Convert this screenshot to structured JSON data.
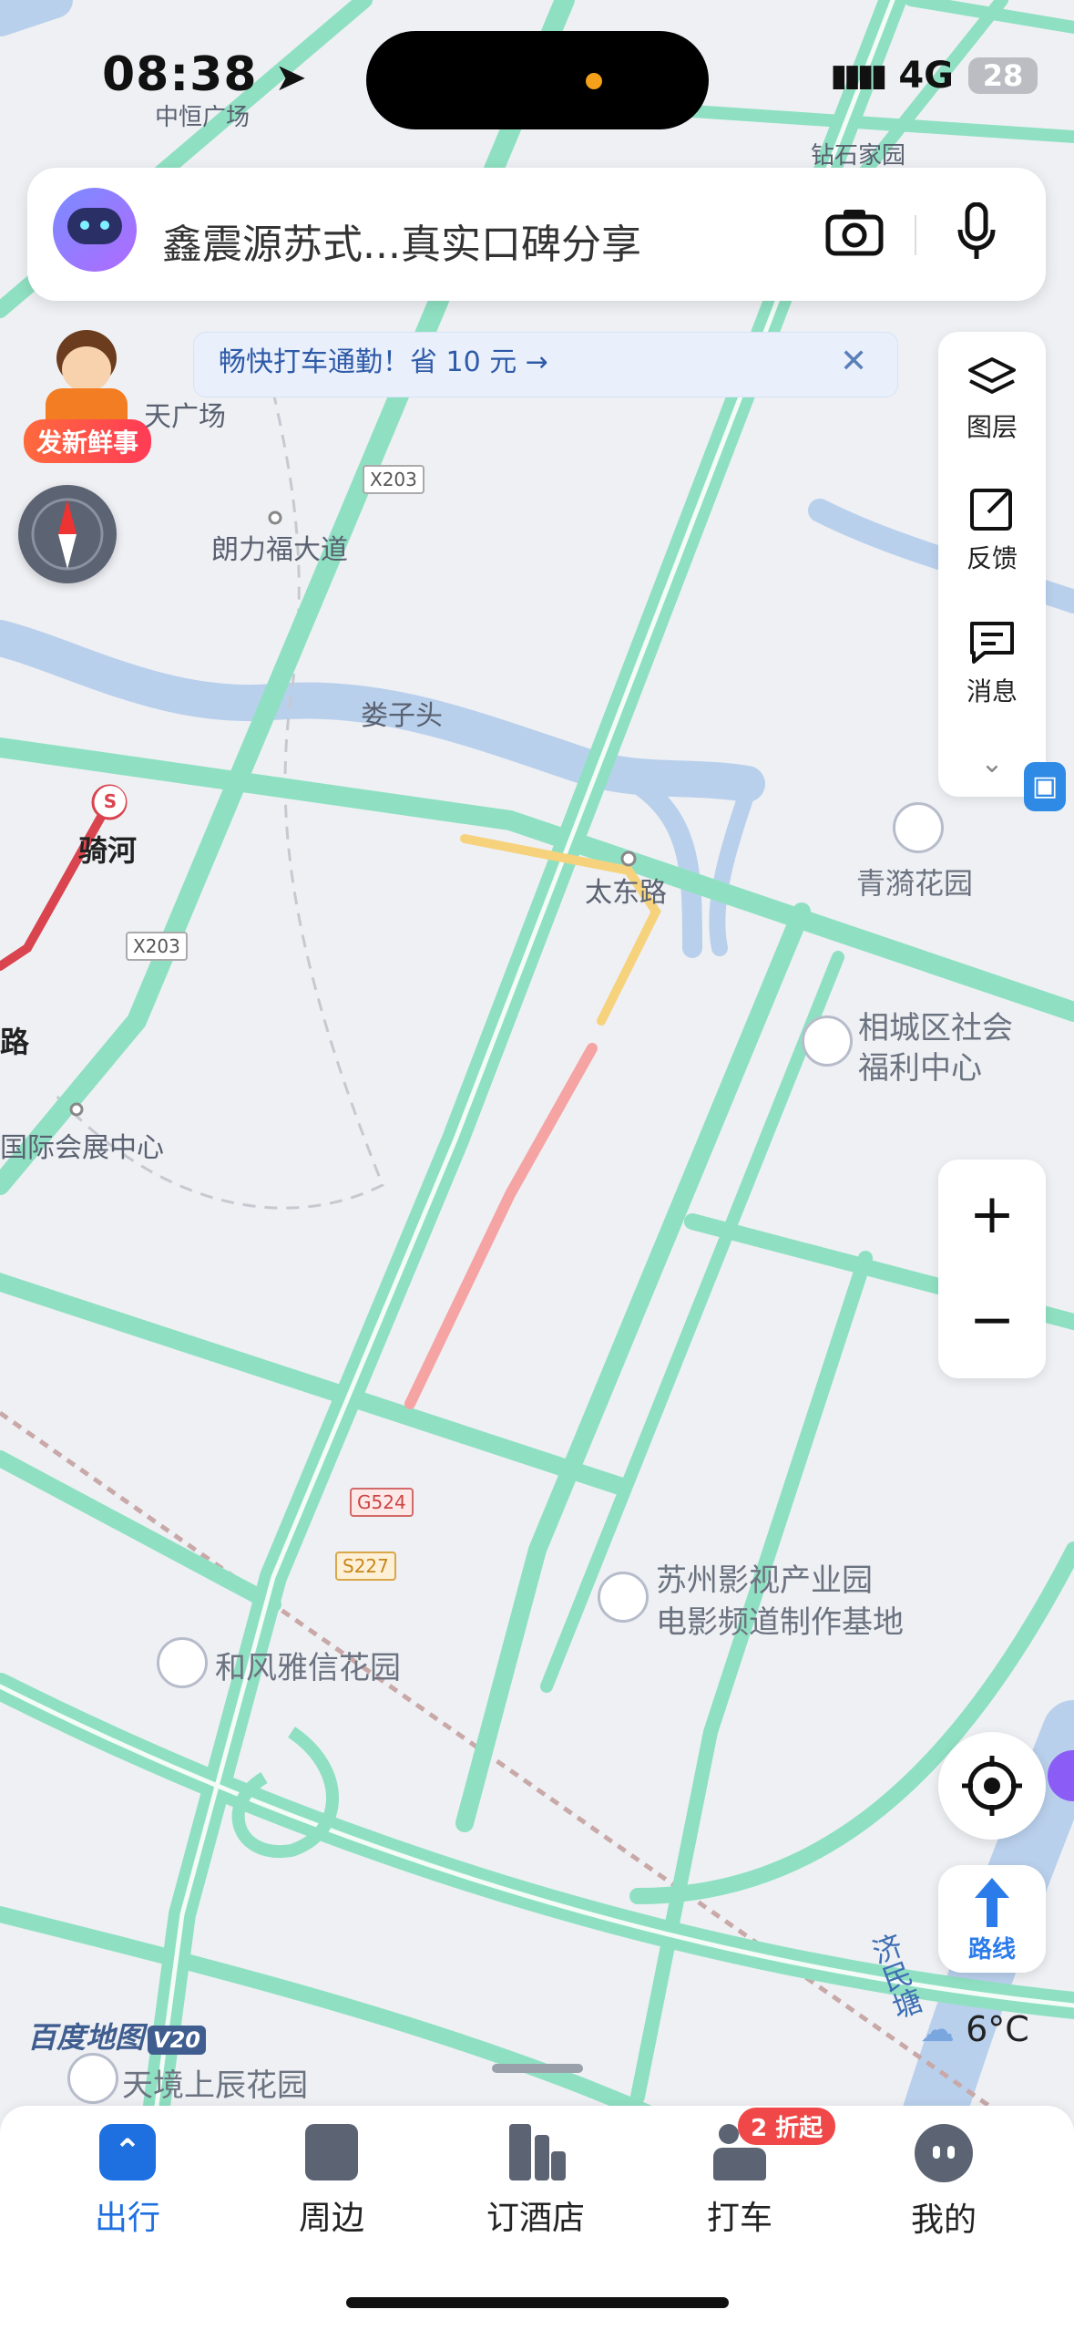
{
  "status_bar": {
    "time": "08:38",
    "network": "4G",
    "battery": "28"
  },
  "search": {
    "text": "鑫震源苏式...真实口碑分享"
  },
  "promo": {
    "text": "畅快打车通勤！省 10 元 →"
  },
  "mascot_badge": "发新鲜事",
  "side_tools": {
    "layers": "图层",
    "feedback": "反馈",
    "messages": "消息"
  },
  "zoom": {
    "in": "+",
    "out": "−"
  },
  "route_button": "路线",
  "weather": {
    "temp": "6°C"
  },
  "brand": {
    "name": "百度地图",
    "version": "V20"
  },
  "map_labels": {
    "zhongheng": "中恒广场",
    "zuanshi": "钻石家园",
    "tian_guangchang": "天广场",
    "langli": "朗力福大道",
    "louzitou": "娄子头",
    "qihe": "骑河",
    "taidong": "太东路",
    "qingyi": "青漪花园",
    "xiangcheng": "相城区社会",
    "xiangcheng2": "福利中心",
    "huizhan": "国际会展中心",
    "lu": "路",
    "yingshi1": "苏州影视产业园",
    "yingshi2": "电影频道制作基地",
    "hefeng": "和风雅信花园",
    "tianjing": "天境上辰花园",
    "jimintang": "济民塘"
  },
  "road_tags": {
    "x203_a": "X203",
    "x203_b": "X203",
    "g524": "G524",
    "s227": "S227"
  },
  "tabs": [
    {
      "label": "出行"
    },
    {
      "label": "周边"
    },
    {
      "label": "订酒店"
    },
    {
      "label": "打车",
      "badge": "2 折起"
    },
    {
      "label": "我的"
    }
  ],
  "colors": {
    "accent": "#1e6fe0",
    "road": "#7fdcbc",
    "river": "#b5cdea"
  }
}
